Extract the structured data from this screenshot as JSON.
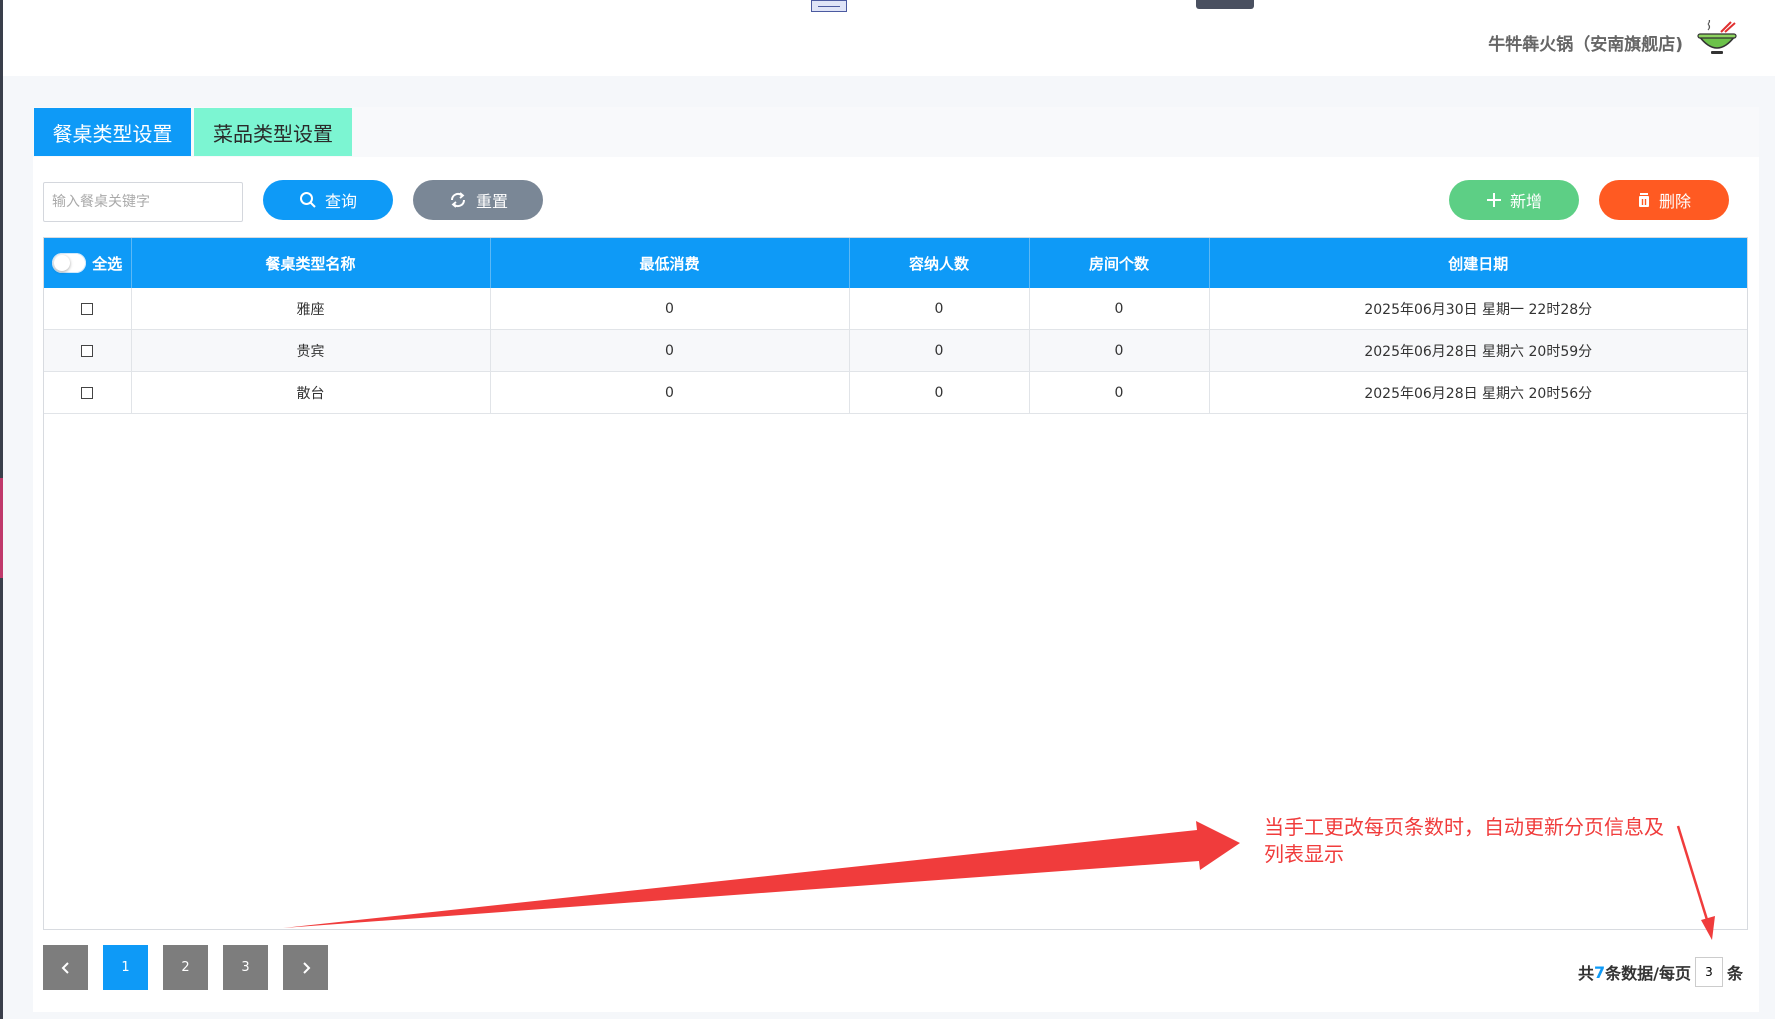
{
  "header": {
    "shop_name": "牛牪犇火锅（安南旗舰店)"
  },
  "tabs": [
    {
      "label": "餐桌类型设置",
      "active": true
    },
    {
      "label": "菜品类型设置",
      "active": false
    }
  ],
  "toolbar": {
    "search_placeholder": "输入餐桌关键字",
    "search_value": "",
    "query_label": "查询",
    "reset_label": "重置",
    "add_label": "新增",
    "delete_label": "删除"
  },
  "table": {
    "select_all_label": "全选",
    "columns": [
      "餐桌类型名称",
      "最低消费",
      "容纳人数",
      "房间个数",
      "创建日期"
    ],
    "rows": [
      {
        "name": "雅座",
        "min_spend": "0",
        "capacity": "0",
        "rooms": "0",
        "created": "2025年06月30日  星期一  22时28分"
      },
      {
        "name": "贵宾",
        "min_spend": "0",
        "capacity": "0",
        "rooms": "0",
        "created": "2025年06月28日  星期六  20时59分"
      },
      {
        "name": "散台",
        "min_spend": "0",
        "capacity": "0",
        "rooms": "0",
        "created": "2025年06月28日  星期六  20时56分"
      }
    ]
  },
  "pagination": {
    "prev_icon": "chevron-left-icon",
    "next_icon": "chevron-right-icon",
    "pages": [
      "1",
      "2",
      "3"
    ],
    "current_page": "1",
    "total_prefix": "共",
    "total_count": "7",
    "total_suffix": "条数据/每页",
    "page_size": "3",
    "unit": "条"
  },
  "annotation": {
    "text": "当手工更改每页条数时，自动更新分页信息及列表显示",
    "color": "#f03c3c"
  },
  "colors": {
    "primary": "#0e9af7",
    "tab_secondary": "#7cf5d2",
    "reset": "#7a8796",
    "add": "#5dcf85",
    "delete": "#ff5a22"
  }
}
